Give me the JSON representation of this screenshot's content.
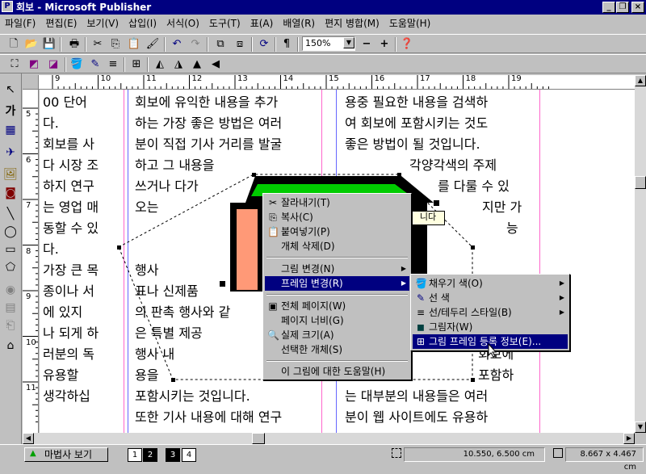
{
  "window": {
    "title": "회보 - Microsoft Publisher",
    "app_icon_letter": "P"
  },
  "menubar": [
    "파일(F)",
    "편집(E)",
    "보기(V)",
    "삽입(I)",
    "서식(O)",
    "도구(T)",
    "표(A)",
    "배열(R)",
    "편지 병합(M)",
    "도움말(H)"
  ],
  "toolbar": {
    "zoom": "150%"
  },
  "ruler": {
    "h_numbers": [
      "9",
      "10",
      "11",
      "12",
      "13",
      "14",
      "15",
      "16",
      "17",
      "18",
      "19"
    ],
    "v_numbers": [
      "5",
      "6",
      "7",
      "8",
      "9",
      "10",
      "11"
    ]
  },
  "document": {
    "col1": [
      "00 단어",
      "다.",
      "회보를 사",
      "다 시장 조",
      "하지 연구",
      "는 영업 매",
      "동할 수 있",
      "다.",
      "가장 큰 목",
      "종이나 서",
      "에 있지",
      "나 되게 하",
      "러분의 독",
      "유용할",
      "생각하십"
    ],
    "col2": [
      "회보에 유익한 내용을 추가",
      "하는 가장 좋은 방법은 여러",
      "분이 직접 기사 거리를 발굴",
      "하고 그 내용을",
      "쓰거나 다가",
      "오는",
      "",
      "",
      "행사",
      "표나 신제품",
      "의 판촉 행사와 같",
      "은 특별 제공",
      "행사 내",
      "용을",
      "포함시키는 것입니다.",
      "또한 기사 내용에 대해 연구"
    ],
    "col3": [
      "용중 필요한 내용을 검색하",
      "여 회보에 포함시키는 것도",
      "좋은 방법이 될 것입니다.",
      "각양각색의 주제",
      "를 다룰 수 있",
      "지만 가",
      "능",
      "",
      "",
      "",
      "",
      "",
      "회보에",
      "포함하",
      "는 대부분의 내용들은 여러",
      "분이 웹 사이트에도 유용하"
    ],
    "tooltip_fragment": "니다"
  },
  "context_menu": {
    "items": [
      {
        "label": "잘라내기(T)",
        "icon": "scissors-icon"
      },
      {
        "label": "복사(C)",
        "icon": "copy-icon"
      },
      {
        "label": "붙여넣기(P)",
        "icon": "paste-icon"
      },
      {
        "label": "개체 삭제(D)",
        "icon": ""
      },
      {
        "label": "그림 변경(N)",
        "icon": "",
        "submenu": true
      },
      {
        "label": "프레임 변경(R)",
        "icon": "",
        "submenu": true,
        "selected": true
      },
      {
        "label": "전체 페이지(W)",
        "icon": "full-page-icon"
      },
      {
        "label": "페이지 너비(G)",
        "icon": ""
      },
      {
        "label": "실제 크기(A)",
        "icon": "magnifier-icon"
      },
      {
        "label": "선택한 개체(S)",
        "icon": ""
      },
      {
        "label": "이 그림에 대한 도움말(H)",
        "icon": ""
      }
    ]
  },
  "submenu": {
    "items": [
      {
        "label": "채우기 색(O)",
        "icon": "fill-bucket-icon",
        "submenu": true
      },
      {
        "label": "선 색",
        "icon": "line-color-icon",
        "submenu": true
      },
      {
        "label": "선/테두리 스타일(B)",
        "icon": "line-style-icon",
        "submenu": true
      },
      {
        "label": "그림자(W)",
        "icon": "shadow-icon"
      },
      {
        "label": "그림 프레임 등록 정보(E)...",
        "icon": "frame-properties-icon",
        "selected": true
      }
    ]
  },
  "statusbar": {
    "wizard_button": "마법사 보기",
    "pages": [
      "1",
      "2",
      "3",
      "4"
    ],
    "position": "10.550, 6.500 cm",
    "size": "8.667 x 4.467 cm"
  },
  "colors": {
    "title": "#000080",
    "house_roof": "#00cc00",
    "house_wall": "#ff9977",
    "selected": "#000080",
    "guide_pink": "#ff66cc",
    "guide_blue": "#6666ff"
  }
}
